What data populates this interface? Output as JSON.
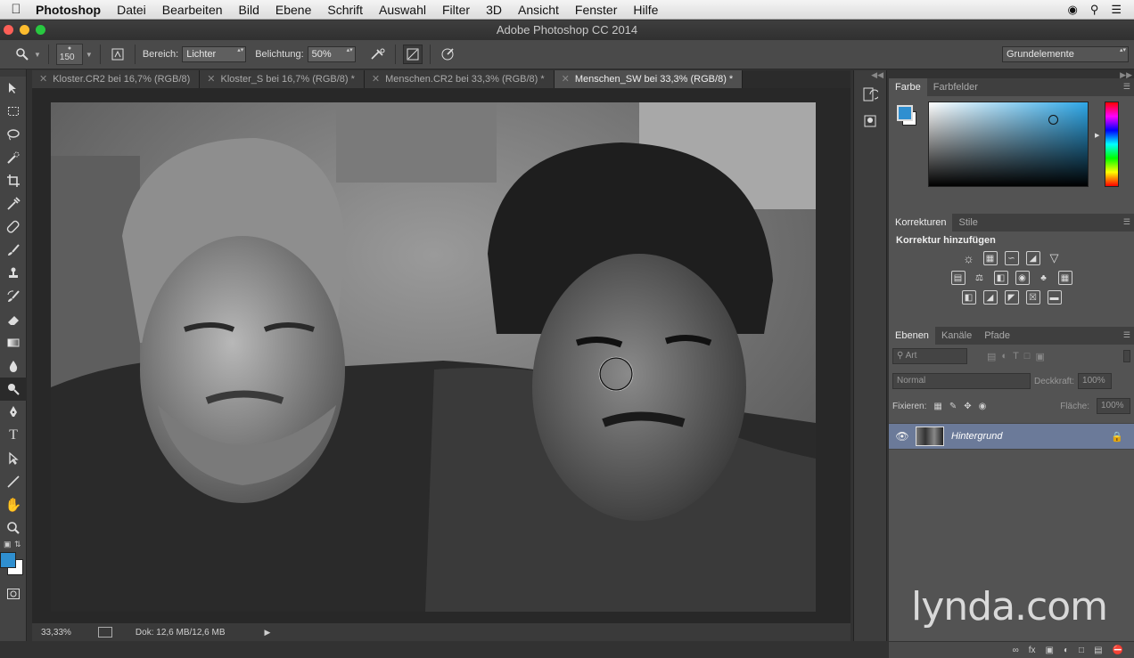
{
  "menubar": {
    "app": "Photoshop",
    "items": [
      "Datei",
      "Bearbeiten",
      "Bild",
      "Ebene",
      "Schrift",
      "Auswahl",
      "Filter",
      "3D",
      "Ansicht",
      "Fenster",
      "Hilfe"
    ]
  },
  "window": {
    "title": "Adobe Photoshop CC 2014"
  },
  "options": {
    "brush_size": "150",
    "range_label": "Bereich:",
    "range_value": "Lichter",
    "exposure_label": "Belichtung:",
    "exposure_value": "50%",
    "workspace": "Grundelemente"
  },
  "tabs": [
    {
      "label": "Kloster.CR2 bei 16,7% (RGB/8)",
      "active": false
    },
    {
      "label": "Kloster_S bei 16,7% (RGB/8) *",
      "active": false
    },
    {
      "label": "Menschen.CR2 bei 33,3% (RGB/8) *",
      "active": false
    },
    {
      "label": "Menschen_SW bei 33,3% (RGB/8) *",
      "active": true
    }
  ],
  "status": {
    "zoom": "33,33%",
    "doc": "Dok: 12,6 MB/12,6 MB"
  },
  "panels": {
    "color": {
      "tabs": [
        "Farbe",
        "Farbfelder"
      ]
    },
    "corrections": {
      "tabs": [
        "Korrekturen",
        "Stile"
      ],
      "heading": "Korrektur hinzufügen"
    },
    "layers": {
      "tabs": [
        "Ebenen",
        "Kanäle",
        "Pfade"
      ],
      "filter_value": "Art",
      "blend_mode": "Normal",
      "opacity_label": "Deckkraft:",
      "opacity_value": "100%",
      "lock_label": "Fixieren:",
      "fill_label": "Fläche:",
      "fill_value": "100%",
      "layer_name": "Hintergrund"
    }
  },
  "colors": {
    "foreground": "#2f8fd0",
    "background": "#ffffff",
    "accent_layer": "#6b7a99"
  },
  "watermark": "lynda.com"
}
